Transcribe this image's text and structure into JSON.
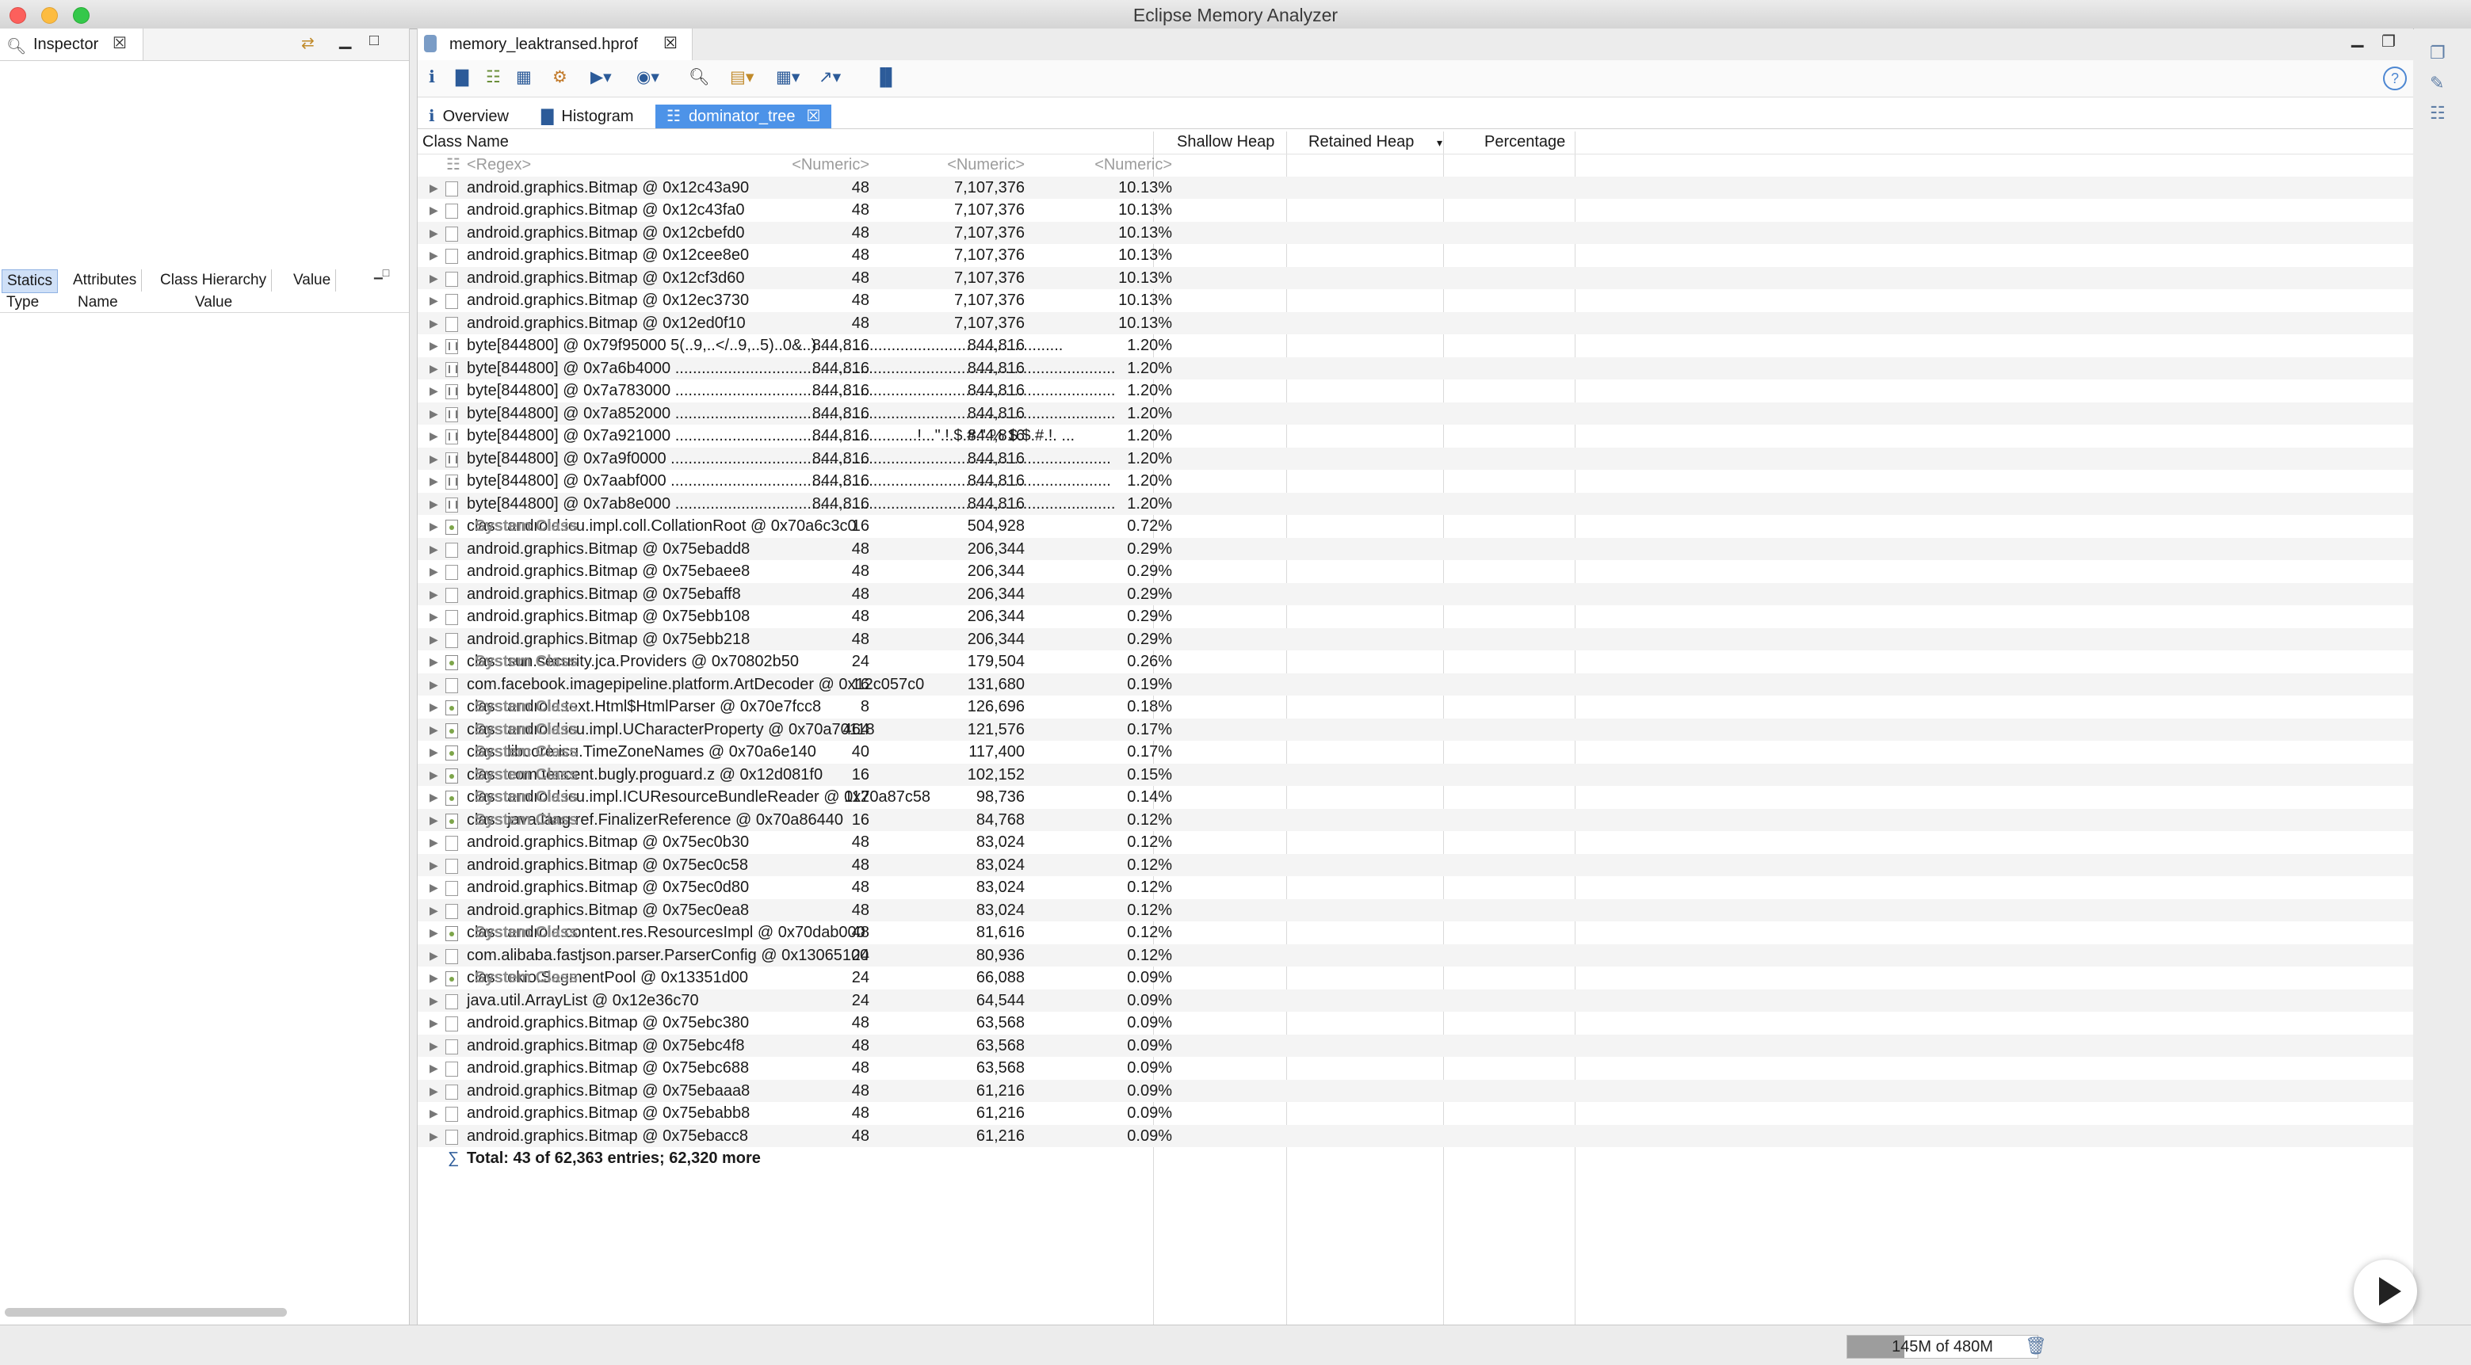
{
  "window": {
    "title": "Eclipse Memory Analyzer"
  },
  "inspector": {
    "tab_label": "Inspector",
    "subtabs": [
      "Statics",
      "Attributes",
      "Class Hierarchy",
      "Value"
    ],
    "columns": [
      "Type",
      "Name",
      "Value"
    ]
  },
  "editor": {
    "file_tab": "memory_leaktransed.hprof",
    "view_tabs": [
      "Overview",
      "Histogram",
      "dominator_tree"
    ],
    "columns": {
      "class_name": "Class Name",
      "shallow": "Shallow Heap",
      "retained": "Retained Heap",
      "percentage": "Percentage"
    },
    "filter_row": {
      "name": "<Regex>",
      "shallow": "<Numeric>",
      "retained": "<Numeric>",
      "percentage": "<Numeric>"
    },
    "rows": [
      {
        "name": "android.graphics.Bitmap @ 0x12c43a90",
        "sys": "",
        "shallow": "48",
        "retained": "7,107,376",
        "pct": "10.13%"
      },
      {
        "name": "android.graphics.Bitmap @ 0x12c43fa0",
        "sys": "",
        "shallow": "48",
        "retained": "7,107,376",
        "pct": "10.13%"
      },
      {
        "name": "android.graphics.Bitmap @ 0x12cbefd0",
        "sys": "",
        "shallow": "48",
        "retained": "7,107,376",
        "pct": "10.13%"
      },
      {
        "name": "android.graphics.Bitmap @ 0x12cee8e0",
        "sys": "",
        "shallow": "48",
        "retained": "7,107,376",
        "pct": "10.13%"
      },
      {
        "name": "android.graphics.Bitmap @ 0x12cf3d60",
        "sys": "",
        "shallow": "48",
        "retained": "7,107,376",
        "pct": "10.13%"
      },
      {
        "name": "android.graphics.Bitmap @ 0x12ec3730",
        "sys": "",
        "shallow": "48",
        "retained": "7,107,376",
        "pct": "10.13%"
      },
      {
        "name": "android.graphics.Bitmap @ 0x12ed0f10",
        "sys": "",
        "shallow": "48",
        "retained": "7,107,376",
        "pct": "10.13%"
      },
      {
        "name": "byte[844800] @ 0x79f95000  5(..9,..</..9,..5)..0&..)........................................................",
        "sys": "",
        "shallow": "844,816",
        "retained": "844,816",
        "pct": "1.20%"
      },
      {
        "name": "byte[844800] @ 0x7a6b4000  ....................................................................................................",
        "sys": "",
        "shallow": "844,816",
        "retained": "844,816",
        "pct": "1.20%"
      },
      {
        "name": "byte[844800] @ 0x7a783000  ....................................................................................................",
        "sys": "",
        "shallow": "844,816",
        "retained": "844,816",
        "pct": "1.20%"
      },
      {
        "name": "byte[844800] @ 0x7a852000  ....................................................................................................",
        "sys": "",
        "shallow": "844,816",
        "retained": "844,816",
        "pct": "1.20%"
      },
      {
        "name": "byte[844800] @ 0x7a921000  .......................................................!...\".!.$.#.\".% $.$.#.!. ...",
        "sys": "",
        "shallow": "844,816",
        "retained": "844,816",
        "pct": "1.20%"
      },
      {
        "name": "byte[844800] @ 0x7a9f0000  ....................................................................................................",
        "sys": "",
        "shallow": "844,816",
        "retained": "844,816",
        "pct": "1.20%"
      },
      {
        "name": "byte[844800] @ 0x7aabf000  ....................................................................................................",
        "sys": "",
        "shallow": "844,816",
        "retained": "844,816",
        "pct": "1.20%"
      },
      {
        "name": "byte[844800] @ 0x7ab8e000  ....................................................................................................",
        "sys": "",
        "shallow": "844,816",
        "retained": "844,816",
        "pct": "1.20%"
      },
      {
        "name": "class android.icu.impl.coll.CollationRoot @ 0x70a6c3c0",
        "sys": "System Class",
        "shallow": "16",
        "retained": "504,928",
        "pct": "0.72%"
      },
      {
        "name": "android.graphics.Bitmap @ 0x75ebadd8",
        "sys": "",
        "shallow": "48",
        "retained": "206,344",
        "pct": "0.29%"
      },
      {
        "name": "android.graphics.Bitmap @ 0x75ebaee8",
        "sys": "",
        "shallow": "48",
        "retained": "206,344",
        "pct": "0.29%"
      },
      {
        "name": "android.graphics.Bitmap @ 0x75ebaff8",
        "sys": "",
        "shallow": "48",
        "retained": "206,344",
        "pct": "0.29%"
      },
      {
        "name": "android.graphics.Bitmap @ 0x75ebb108",
        "sys": "",
        "shallow": "48",
        "retained": "206,344",
        "pct": "0.29%"
      },
      {
        "name": "android.graphics.Bitmap @ 0x75ebb218",
        "sys": "",
        "shallow": "48",
        "retained": "206,344",
        "pct": "0.29%"
      },
      {
        "name": "class sun.security.jca.Providers @ 0x70802b50",
        "sys": "System Class",
        "shallow": "24",
        "retained": "179,504",
        "pct": "0.26%"
      },
      {
        "name": "com.facebook.imagepipeline.platform.ArtDecoder @ 0x12c057c0",
        "sys": "",
        "shallow": "16",
        "retained": "131,680",
        "pct": "0.19%"
      },
      {
        "name": "class android.text.Html$HtmlParser @ 0x70e7fcc8",
        "sys": "System Class",
        "shallow": "8",
        "retained": "126,696",
        "pct": "0.18%"
      },
      {
        "name": "class android.icu.impl.UCharacterProperty @ 0x70a70118",
        "sys": "System Class",
        "shallow": "464",
        "retained": "121,576",
        "pct": "0.17%"
      },
      {
        "name": "class libcore.icu.TimeZoneNames @ 0x70a6e140",
        "sys": "System Class",
        "shallow": "40",
        "retained": "117,400",
        "pct": "0.17%"
      },
      {
        "name": "class com.tencent.bugly.proguard.z @ 0x12d081f0",
        "sys": "System Class",
        "shallow": "16",
        "retained": "102,152",
        "pct": "0.15%"
      },
      {
        "name": "class android.icu.impl.ICUResourceBundleReader @ 0x70a87c58",
        "sys": "System Class",
        "shallow": "112",
        "retained": "98,736",
        "pct": "0.14%"
      },
      {
        "name": "class java.lang.ref.FinalizerReference @ 0x70a86440",
        "sys": "System Class",
        "shallow": "16",
        "retained": "84,768",
        "pct": "0.12%"
      },
      {
        "name": "android.graphics.Bitmap @ 0x75ec0b30",
        "sys": "",
        "shallow": "48",
        "retained": "83,024",
        "pct": "0.12%"
      },
      {
        "name": "android.graphics.Bitmap @ 0x75ec0c58",
        "sys": "",
        "shallow": "48",
        "retained": "83,024",
        "pct": "0.12%"
      },
      {
        "name": "android.graphics.Bitmap @ 0x75ec0d80",
        "sys": "",
        "shallow": "48",
        "retained": "83,024",
        "pct": "0.12%"
      },
      {
        "name": "android.graphics.Bitmap @ 0x75ec0ea8",
        "sys": "",
        "shallow": "48",
        "retained": "83,024",
        "pct": "0.12%"
      },
      {
        "name": "class android.content.res.ResourcesImpl @ 0x70dab000",
        "sys": "System Class",
        "shallow": "48",
        "retained": "81,616",
        "pct": "0.12%"
      },
      {
        "name": "com.alibaba.fastjson.parser.ParserConfig @ 0x13065100",
        "sys": "",
        "shallow": "24",
        "retained": "80,936",
        "pct": "0.12%"
      },
      {
        "name": "class okio.SegmentPool @ 0x13351d00",
        "sys": "System Class",
        "shallow": "24",
        "retained": "66,088",
        "pct": "0.09%"
      },
      {
        "name": "java.util.ArrayList @ 0x12e36c70",
        "sys": "",
        "shallow": "24",
        "retained": "64,544",
        "pct": "0.09%"
      },
      {
        "name": "android.graphics.Bitmap @ 0x75ebc380",
        "sys": "",
        "shallow": "48",
        "retained": "63,568",
        "pct": "0.09%"
      },
      {
        "name": "android.graphics.Bitmap @ 0x75ebc4f8",
        "sys": "",
        "shallow": "48",
        "retained": "63,568",
        "pct": "0.09%"
      },
      {
        "name": "android.graphics.Bitmap @ 0x75ebc688",
        "sys": "",
        "shallow": "48",
        "retained": "63,568",
        "pct": "0.09%"
      },
      {
        "name": "android.graphics.Bitmap @ 0x75ebaaa8",
        "sys": "",
        "shallow": "48",
        "retained": "61,216",
        "pct": "0.09%"
      },
      {
        "name": "android.graphics.Bitmap @ 0x75ebabb8",
        "sys": "",
        "shallow": "48",
        "retained": "61,216",
        "pct": "0.09%"
      },
      {
        "name": "android.graphics.Bitmap @ 0x75ebacc8",
        "sys": "",
        "shallow": "48",
        "retained": "61,216",
        "pct": "0.09%"
      }
    ],
    "total": "Total: 43 of 62,363 entries; 62,320 more"
  },
  "status": {
    "memory": "145M of 480M",
    "memory_used_fraction": 0.3
  }
}
